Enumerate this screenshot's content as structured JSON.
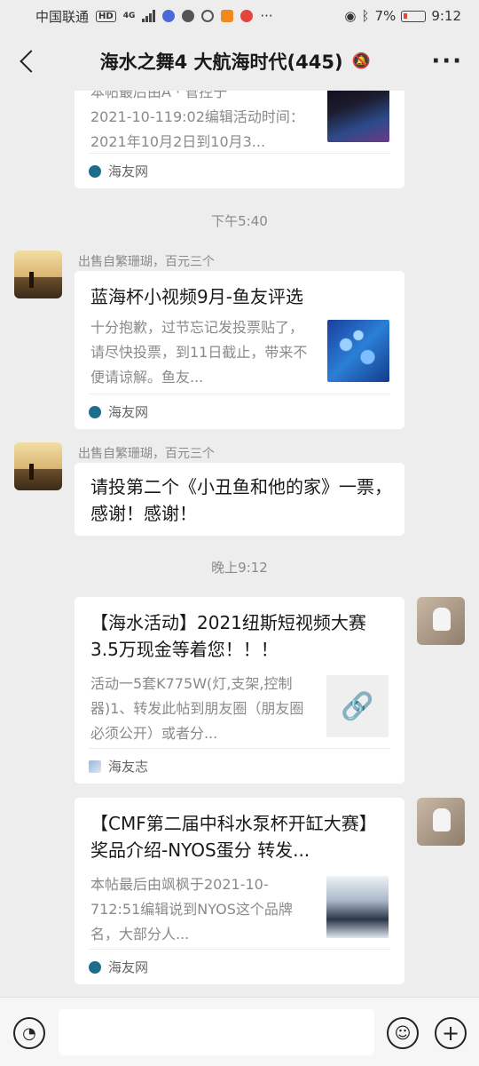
{
  "status_bar": {
    "carrier": "中国联通",
    "hd": "HD",
    "network": "4G",
    "battery": "7%",
    "time": "9:12"
  },
  "header": {
    "title": "海水之舞4 大航海时代(445)",
    "more": "···"
  },
  "messages": {
    "m1": {
      "partial_text": "本帖最后由A · 管控于",
      "desc": "2021-10-119:02编辑活动时间：2021年10月2日到10月3...",
      "source": "海友网"
    },
    "time1": "下午5:40",
    "m2": {
      "sender": "出售自繁珊瑚，百元三个",
      "title": "蓝海杯小视频9月-鱼友评选",
      "desc": "十分抱歉，过节忘记发投票贴了，请尽快投票，到11日截止，带来不便请谅解。鱼友...",
      "source": "海友网"
    },
    "m3": {
      "sender": "出售自繁珊瑚，百元三个",
      "text": "请投第二个《小丑鱼和他的家》一票，感谢！感谢！"
    },
    "time2": "晚上9:12",
    "m4": {
      "title": "【海水活动】2021纽斯短视频大赛 3.5万现金等着您！！！",
      "desc": "活动一5套K775W(灯,支架,控制器)1、转发此帖到朋友圈（朋友圈必须公开）或者分...",
      "source": "海友志"
    },
    "m5": {
      "title": "【CMF第二届中科水泵杯开缸大赛】奖品介绍-NYOS蛋分 转发...",
      "desc": "本帖最后由飒枫于2021-10-712:51编辑说到NYOS这个品牌名，大部分人...",
      "source": "海友网"
    }
  },
  "input_bar": {
    "voice_icon": "voice-icon",
    "emoji_icon": "emoji-icon",
    "plus_icon": "plus-icon"
  }
}
